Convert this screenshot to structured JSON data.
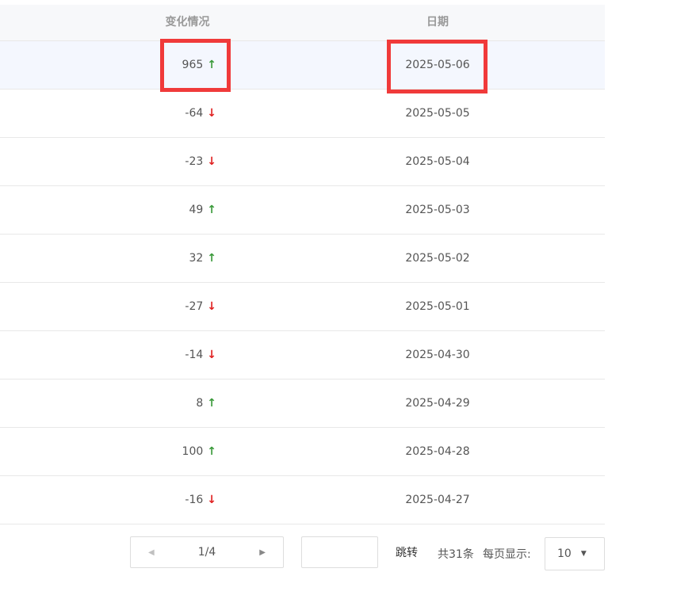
{
  "table": {
    "columns": {
      "change": "变化情况",
      "date": "日期"
    },
    "rows": [
      {
        "change": "965",
        "direction": "up",
        "date": "2025-05-06"
      },
      {
        "change": "-64",
        "direction": "down",
        "date": "2025-05-05"
      },
      {
        "change": "-23",
        "direction": "down",
        "date": "2025-05-04"
      },
      {
        "change": "49",
        "direction": "up",
        "date": "2025-05-03"
      },
      {
        "change": "32",
        "direction": "up",
        "date": "2025-05-02"
      },
      {
        "change": "-27",
        "direction": "down",
        "date": "2025-05-01"
      },
      {
        "change": "-14",
        "direction": "down",
        "date": "2025-04-30"
      },
      {
        "change": "8",
        "direction": "up",
        "date": "2025-04-29"
      },
      {
        "change": "100",
        "direction": "up",
        "date": "2025-04-28"
      },
      {
        "change": "-16",
        "direction": "down",
        "date": "2025-04-27"
      }
    ]
  },
  "icons": {
    "up": "arrow-up-icon",
    "down": "arrow-down-icon",
    "prev": "caret-left-icon",
    "next": "caret-right-icon",
    "dropdown": "caret-down-icon"
  },
  "colors": {
    "up": "#3a9a3a",
    "down": "#e02020",
    "highlight_row": "#f4f7fe",
    "annotation": "#f03a3a"
  },
  "pagination": {
    "page_indicator": "1/4",
    "jump_value": "",
    "jump_label": "跳转",
    "total": "共31条",
    "per_page_label": "每页显示:",
    "per_page_value": "10"
  }
}
